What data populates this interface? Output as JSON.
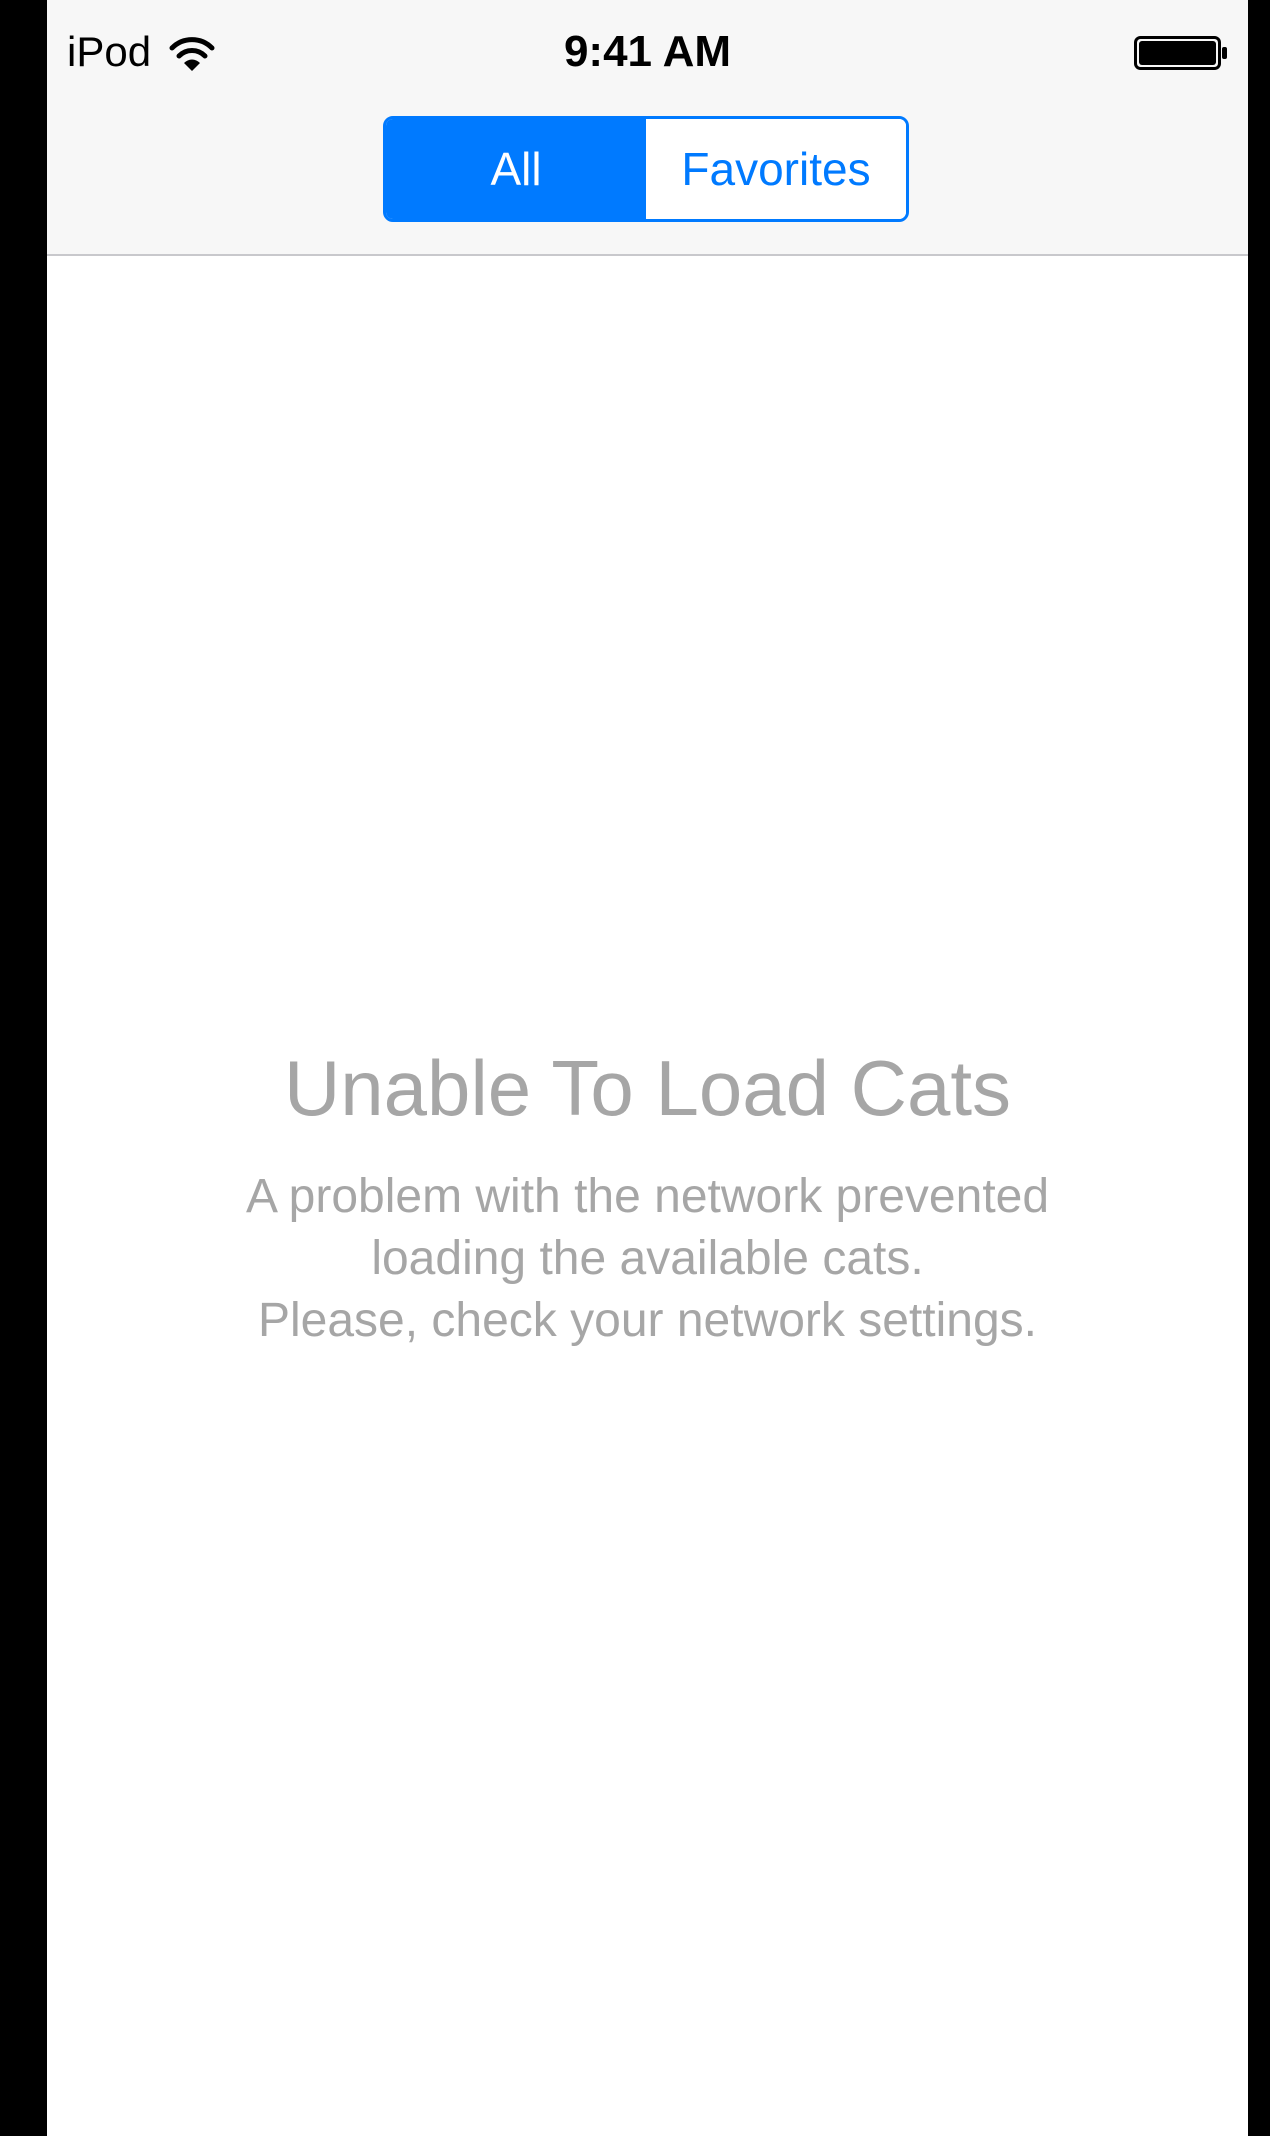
{
  "status_bar": {
    "carrier": "iPod",
    "wifi_icon": "wifi-icon",
    "time": "9:41 AM",
    "battery_icon": "battery-icon"
  },
  "nav_bar": {
    "segments": [
      {
        "label": "All",
        "selected": true
      },
      {
        "label": "Favorites",
        "selected": false
      }
    ]
  },
  "empty_state": {
    "title": "Unable To Load Cats",
    "message_lines": [
      "A problem with the network prevented",
      "loading the available cats.",
      "Please, check your network settings."
    ]
  },
  "colors": {
    "accent": "#007aff",
    "bar_background": "#f7f7f7",
    "empty_text": "#a6a6a6"
  }
}
